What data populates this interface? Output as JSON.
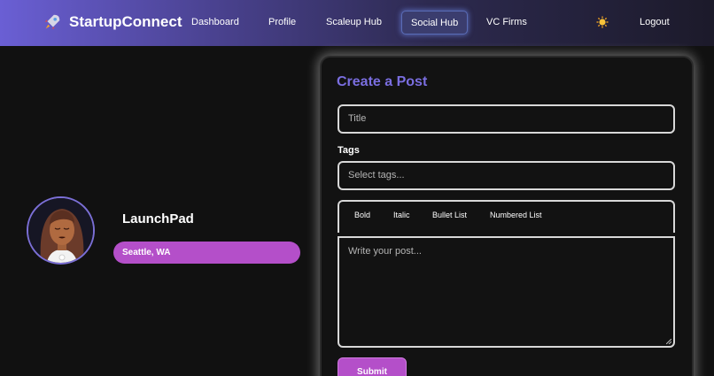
{
  "brand": {
    "name": "StartupConnect",
    "icon": "rocket-icon"
  },
  "nav": {
    "links": [
      {
        "label": "Dashboard",
        "active": false
      },
      {
        "label": "Profile",
        "active": false
      },
      {
        "label": "Scaleup Hub",
        "active": false
      },
      {
        "label": "Social Hub",
        "active": true
      },
      {
        "label": "VC Firms",
        "active": false
      }
    ],
    "theme_icon": "sun-icon",
    "logout_label": "Logout"
  },
  "profile": {
    "name": "LaunchPad",
    "location": "Seattle, WA"
  },
  "post_form": {
    "title": "Create a Post",
    "title_placeholder": "Title",
    "tags_label": "Tags",
    "tags_placeholder": "Select tags...",
    "toolbar": [
      "Bold",
      "Italic",
      "Bullet List",
      "Numbered List"
    ],
    "body_placeholder": "Write your post...",
    "submit_label": "Submit"
  },
  "colors": {
    "accent_purple": "#b44fc9",
    "title_purple": "#7a6ee0",
    "background": "#111111"
  }
}
